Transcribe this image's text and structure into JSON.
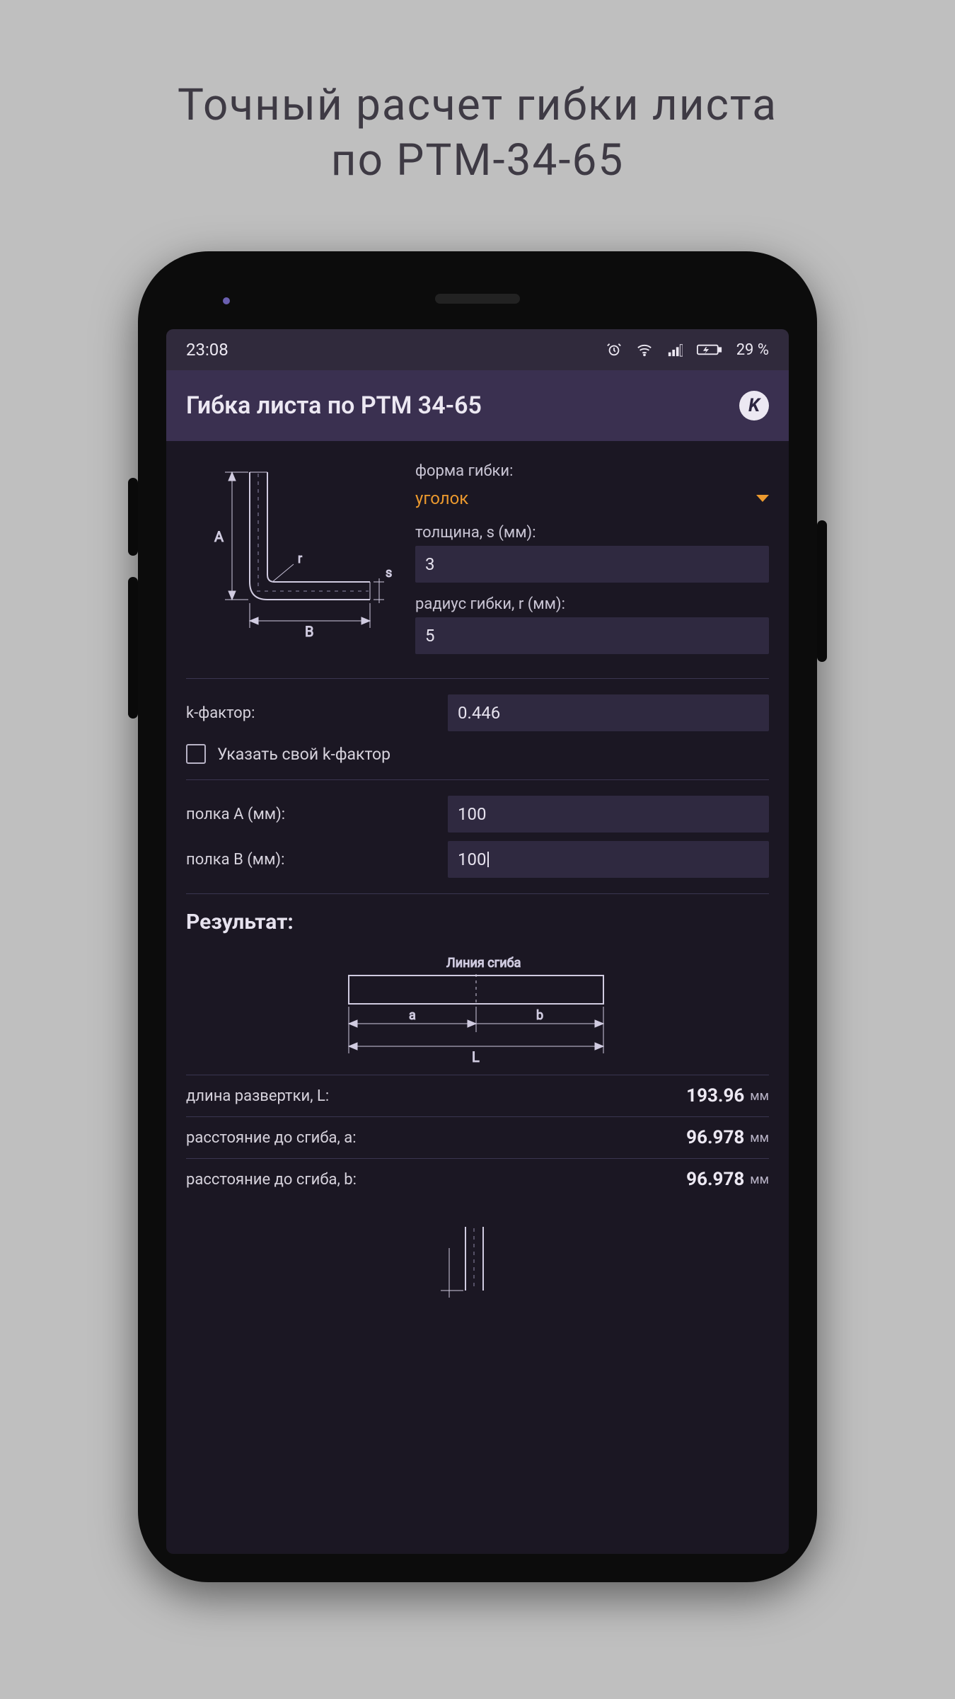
{
  "promo": {
    "line1": "Точный расчет гибки листа",
    "line2": "по РТМ-34-65"
  },
  "status": {
    "time": "23:08",
    "battery_text": "29 %"
  },
  "appbar": {
    "title": "Гибка листа по РТМ 34-65",
    "badge": "K"
  },
  "form": {
    "shape_label": "форма гибки:",
    "shape_value": "уголок",
    "thickness_label": "толщина, s (мм):",
    "thickness_value": "3",
    "radius_label": "радиус гибки, r (мм):",
    "radius_value": "5",
    "kfactor_label": "k-фактор:",
    "kfactor_value": "0.446",
    "custom_kfactor_label": "Указать свой k-фактор",
    "flangeA_label": "полка А (мм):",
    "flangeA_value": "100",
    "flangeB_label": "полка В (мм):",
    "flangeB_value": "100"
  },
  "diagram": {
    "A": "A",
    "B": "B",
    "r": "r",
    "s": "s",
    "bend_line": "Линия сгиба",
    "a": "a",
    "b": "b",
    "L": "L"
  },
  "result": {
    "heading": "Результат:",
    "rows": [
      {
        "label": "длина развертки, L:",
        "value": "193.96",
        "unit": "мм"
      },
      {
        "label": "расстояние до сгиба, a:",
        "value": "96.978",
        "unit": "мм"
      },
      {
        "label": "расстояние до сгиба, b:",
        "value": "96.978",
        "unit": "мм"
      }
    ]
  }
}
